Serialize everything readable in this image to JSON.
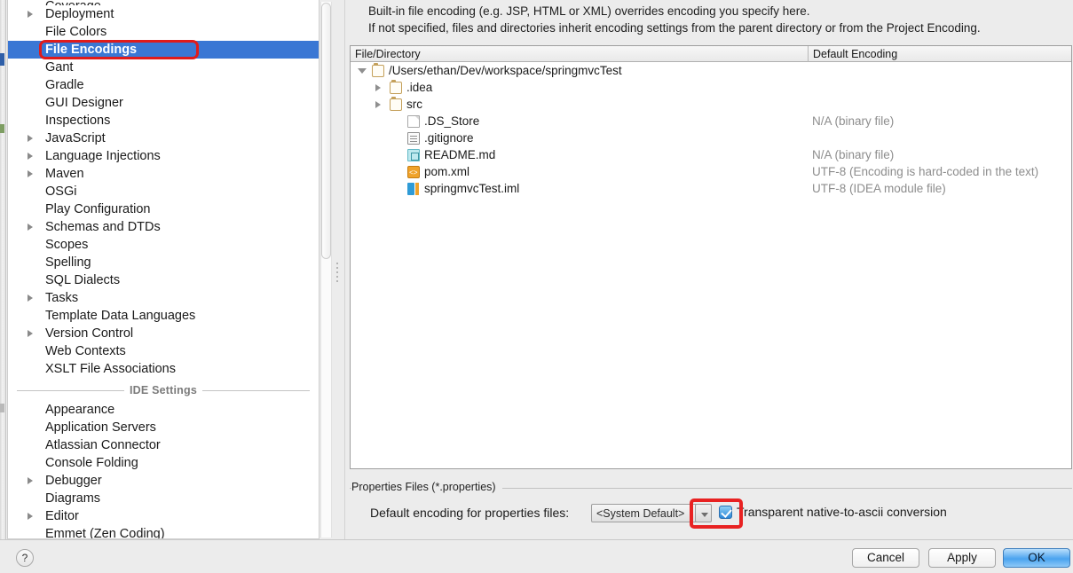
{
  "sidebar": {
    "project_items": [
      {
        "label": "Coverage",
        "expandable": true,
        "clipped": true
      },
      {
        "label": "Deployment",
        "expandable": true
      },
      {
        "label": "File Colors",
        "expandable": false
      },
      {
        "label": "File Encodings",
        "expandable": false,
        "selected": true,
        "annotated": true
      },
      {
        "label": "Gant",
        "expandable": false
      },
      {
        "label": "Gradle",
        "expandable": false
      },
      {
        "label": "GUI Designer",
        "expandable": false
      },
      {
        "label": "Inspections",
        "expandable": false
      },
      {
        "label": "JavaScript",
        "expandable": true
      },
      {
        "label": "Language Injections",
        "expandable": true
      },
      {
        "label": "Maven",
        "expandable": true
      },
      {
        "label": "OSGi",
        "expandable": false
      },
      {
        "label": "Play Configuration",
        "expandable": false
      },
      {
        "label": "Schemas and DTDs",
        "expandable": true
      },
      {
        "label": "Scopes",
        "expandable": false
      },
      {
        "label": "Spelling",
        "expandable": false
      },
      {
        "label": "SQL Dialects",
        "expandable": false
      },
      {
        "label": "Tasks",
        "expandable": true
      },
      {
        "label": "Template Data Languages",
        "expandable": false
      },
      {
        "label": "Version Control",
        "expandable": true
      },
      {
        "label": "Web Contexts",
        "expandable": false
      },
      {
        "label": "XSLT File Associations",
        "expandable": false
      }
    ],
    "group_separator_label": "IDE Settings",
    "ide_items": [
      {
        "label": "Appearance",
        "expandable": false
      },
      {
        "label": "Application Servers",
        "expandable": false
      },
      {
        "label": "Atlassian Connector",
        "expandable": false
      },
      {
        "label": "Console Folding",
        "expandable": false
      },
      {
        "label": "Debugger",
        "expandable": true
      },
      {
        "label": "Diagrams",
        "expandable": false
      },
      {
        "label": "Editor",
        "expandable": true
      },
      {
        "label": "Emmet (Zen Coding)",
        "expandable": false
      }
    ]
  },
  "main": {
    "description_line1": "Built-in file encoding (e.g. JSP, HTML or XML) overrides encoding you specify here.",
    "description_line2": "If not specified, files and directories inherit encoding settings from the parent directory or from the Project Encoding.",
    "table": {
      "columns": [
        "File/Directory",
        "Default Encoding"
      ],
      "rows": [
        {
          "name": "/Users/ethan/Dev/workspace/springmvcTest",
          "icon": "folder-icon",
          "encoding": "",
          "depth": 0,
          "twisty": "open"
        },
        {
          "name": ".idea",
          "icon": "folder-icon",
          "encoding": "",
          "depth": 1,
          "twisty": "closed"
        },
        {
          "name": "src",
          "icon": "folder-icon",
          "encoding": "",
          "depth": 1,
          "twisty": "closed"
        },
        {
          "name": ".DS_Store",
          "icon": "binary-file-icon",
          "encoding": "N/A (binary file)",
          "depth": 2,
          "twisty": "none"
        },
        {
          "name": ".gitignore",
          "icon": "text-file-icon",
          "encoding": "",
          "depth": 2,
          "twisty": "none"
        },
        {
          "name": "README.md",
          "icon": "markdown-file-icon",
          "encoding": "N/A (binary file)",
          "depth": 2,
          "twisty": "none"
        },
        {
          "name": "pom.xml",
          "icon": "xml-file-icon",
          "encoding": "UTF-8 (Encoding is hard-coded in the text)",
          "depth": 2,
          "twisty": "none"
        },
        {
          "name": "springmvcTest.iml",
          "icon": "module-file-icon",
          "encoding": "UTF-8 (IDEA module file)",
          "depth": 2,
          "twisty": "none"
        }
      ]
    },
    "properties_group": {
      "title": "Properties Files (*.properties)",
      "encoding_label": "Default encoding for properties files:",
      "encoding_value": "<System Default>",
      "checkbox_label": "Transparent native-to-ascii conversion",
      "checkbox_checked": true
    }
  },
  "footer": {
    "help_label": "?",
    "cancel_label": "Cancel",
    "apply_label": "Apply",
    "ok_label": "OK"
  },
  "colors": {
    "selection_blue": "#3a77d4",
    "annotation_red": "#e01b1b",
    "default_button_blue": "#4aa3ef",
    "muted_text": "#8d8d8d"
  }
}
